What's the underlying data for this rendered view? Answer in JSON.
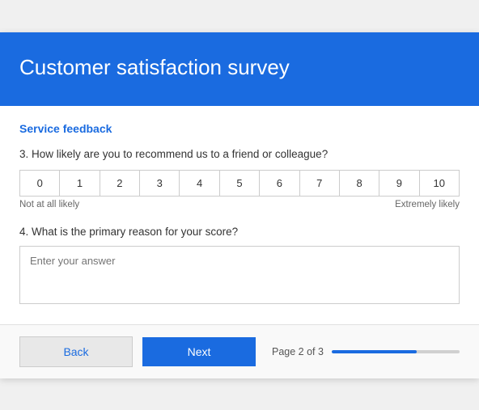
{
  "header": {
    "title": "Customer satisfaction survey"
  },
  "section": {
    "title": "Service feedback"
  },
  "questions": {
    "q3": {
      "label": "3. How likely are you to recommend us to a friend or colleague?",
      "scale": [
        "0",
        "1",
        "2",
        "3",
        "4",
        "5",
        "6",
        "7",
        "8",
        "9",
        "10"
      ],
      "label_low": "Not at all likely",
      "label_high": "Extremely likely"
    },
    "q4": {
      "label": "4. What is the primary reason for your score?",
      "placeholder": "Enter your answer"
    }
  },
  "footer": {
    "back_label": "Back",
    "next_label": "Next",
    "page_label": "Page 2 of 3",
    "progress_pct": 66.6
  }
}
